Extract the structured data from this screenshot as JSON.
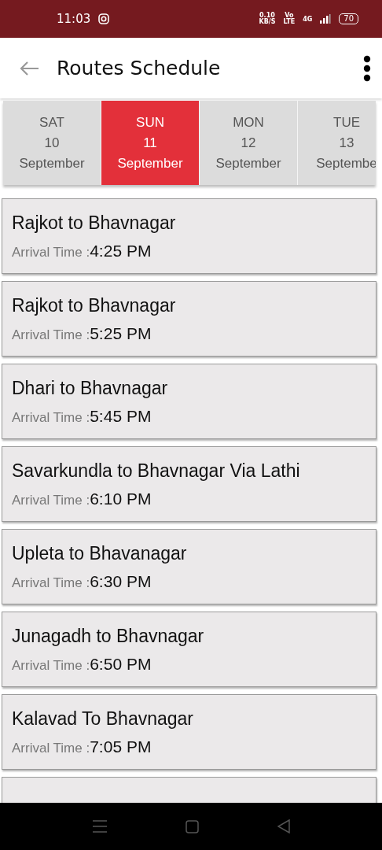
{
  "status_bar": {
    "time": "11:03",
    "speed": "0.10",
    "speed_unit": "KB/S",
    "volte_top": "Vo",
    "volte_bottom": "LTE",
    "network": "4G",
    "battery": "70"
  },
  "app_bar": {
    "title": "Routes Schedule"
  },
  "days": [
    {
      "weekday": "SAT",
      "day": "10",
      "month": "September",
      "selected": false
    },
    {
      "weekday": "SUN",
      "day": "11",
      "month": "September",
      "selected": true
    },
    {
      "weekday": "MON",
      "day": "12",
      "month": "September",
      "selected": false
    },
    {
      "weekday": "TUE",
      "day": "13",
      "month": "Septembe",
      "selected": false
    }
  ],
  "routes": [
    {
      "route": "Rajkot to Bhavnagar",
      "arrival_label": "Arrival Time :",
      "arrival_time": "4:25 PM"
    },
    {
      "route": "Rajkot to Bhavnagar",
      "arrival_label": "Arrival Time :",
      "arrival_time": "5:25 PM"
    },
    {
      "route": "Dhari to Bhavnagar",
      "arrival_label": "Arrival Time :",
      "arrival_time": "5:45 PM"
    },
    {
      "route": "Savarkundla to Bhavnagar Via Lathi",
      "arrival_label": "Arrival Time :",
      "arrival_time": "6:10 PM"
    },
    {
      "route": "Upleta to Bhavanagar",
      "arrival_label": "Arrival Time :",
      "arrival_time": "6:30 PM"
    },
    {
      "route": "Junagadh to Bhavnagar",
      "arrival_label": "Arrival Time :",
      "arrival_time": "6:50 PM"
    },
    {
      "route": "Kalavad To Bhavnagar",
      "arrival_label": "Arrival Time :",
      "arrival_time": "7:05 PM"
    }
  ]
}
